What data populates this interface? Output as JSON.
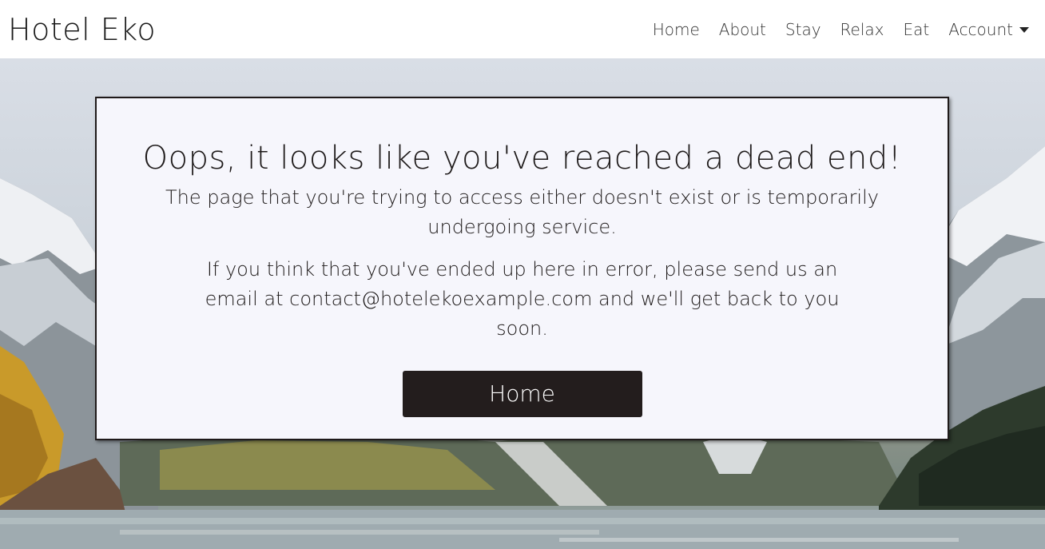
{
  "navbar": {
    "brand": "Hotel Eko",
    "links": [
      "Home",
      "About",
      "Stay",
      "Relax",
      "Eat"
    ],
    "account_label": "Account",
    "account_icon": "caret-down-icon"
  },
  "error_card": {
    "title": "Oops, it looks like you've reached a dead end!",
    "message": "The page that you're trying to access either doesn't exist or is temporarily undergoing service.",
    "contact_message": "If you think that you've ended up here in error, please send us an email at contact@hotelekoexample.com and we'll get back to you soon.",
    "home_button": "Home"
  },
  "colors": {
    "card_background": "#f6f6fc",
    "button_background": "#231d1d",
    "text": "#1e1a1a"
  }
}
